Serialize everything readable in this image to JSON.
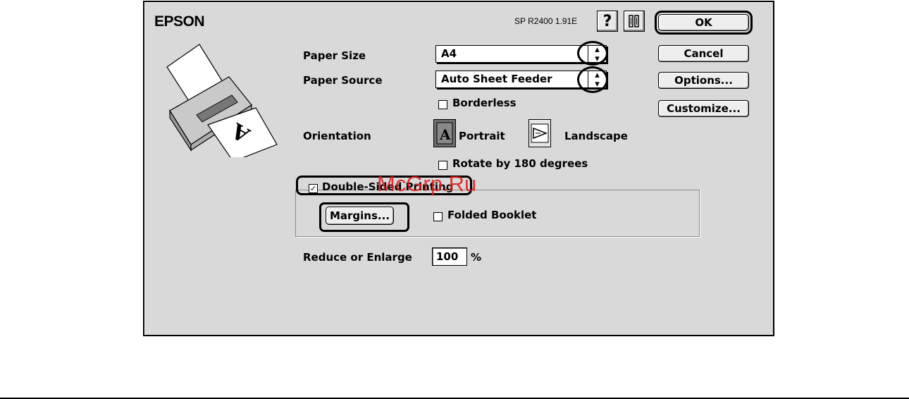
{
  "dialog": {
    "brand": "EPSON",
    "version": "SP R2400 1.91E",
    "help_icon_glyph": "?",
    "tools_icon_glyph": "⚙"
  },
  "fields": {
    "paper_size_label": "Paper Size",
    "paper_size_value": "A4",
    "paper_source_label": "Paper Source",
    "paper_source_value": "Auto Sheet Feeder",
    "borderless_label": "Borderless",
    "borderless_checked": false,
    "orientation_label": "Orientation",
    "portrait_label": "Portrait",
    "landscape_label": "Landscape",
    "orientation_selected": "Portrait",
    "rotate_label": "Rotate by 180 degrees",
    "rotate_checked": false,
    "double_sided_label": "Double-Sided Printing",
    "double_sided_checked": true,
    "margins_button": "Margins...",
    "folded_booklet_label": "Folded Booklet",
    "folded_booklet_checked": false,
    "reduce_label": "Reduce or Enlarge",
    "reduce_value": "100",
    "reduce_unit": "%"
  },
  "buttons": {
    "ok": "OK",
    "cancel": "Cancel",
    "options": "Options...",
    "customize": "Customize..."
  },
  "watermark": "McGrp.Ru"
}
